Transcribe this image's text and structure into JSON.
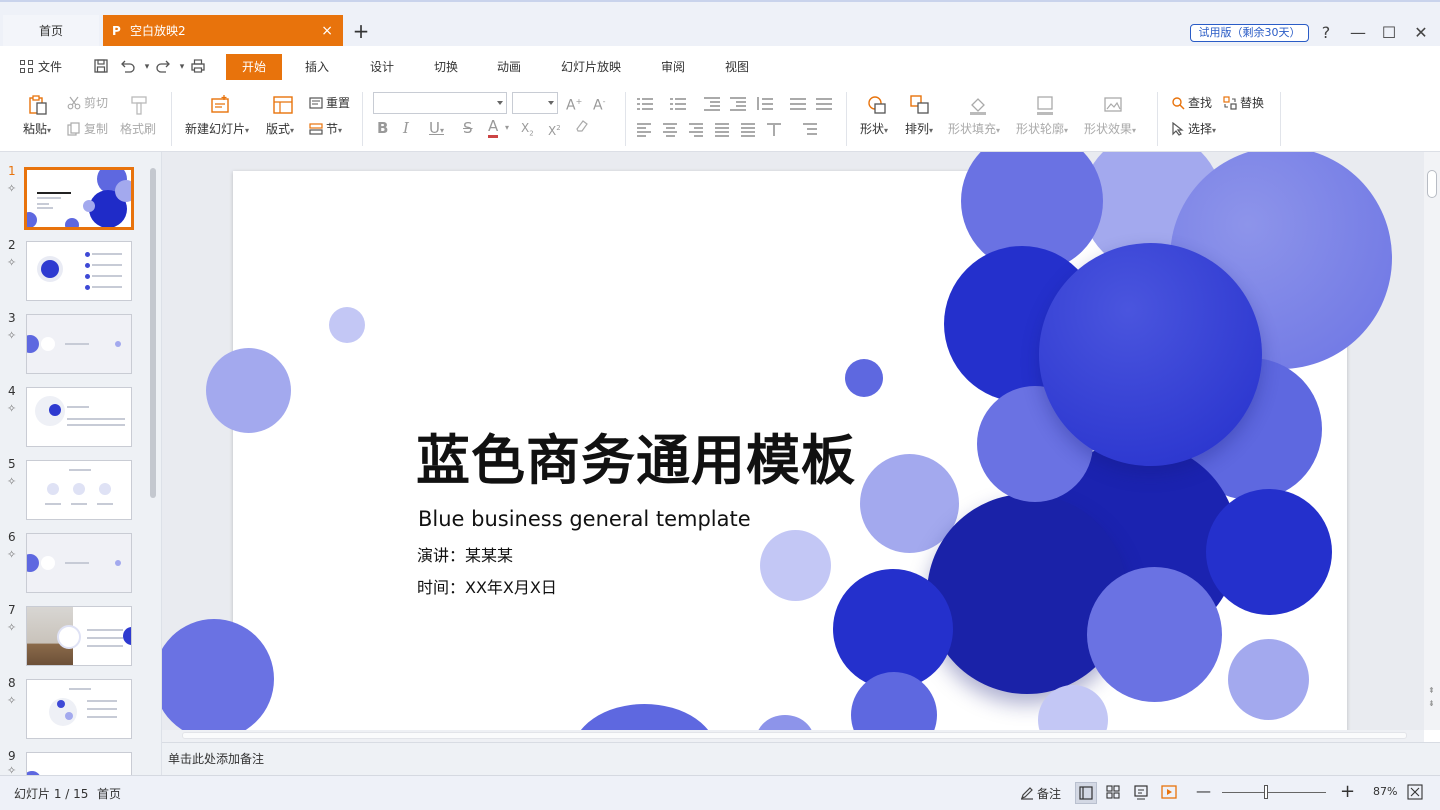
{
  "tabs": {
    "home": "首页",
    "document": "空白放映2",
    "logo": "P",
    "close": "×",
    "add": "+"
  },
  "trial_badge": "试用版（剩余30天）",
  "window_controls": {
    "help": "?",
    "minimize": "—",
    "maximize": "☐",
    "close": "✕"
  },
  "menu": {
    "file": "文件",
    "items": [
      "开始",
      "插入",
      "设计",
      "切换",
      "动画",
      "幻灯片放映",
      "审阅",
      "视图"
    ],
    "active_index": 0
  },
  "ribbon": {
    "paste": "粘贴",
    "cut": "剪切",
    "copy": "复制",
    "format_painter": "格式刷",
    "new_slide": "新建幻灯片",
    "layout": "版式",
    "reset": "重置",
    "section": "节",
    "shape": "形状",
    "arrange": "排列",
    "shape_fill": "形状填充",
    "shape_outline": "形状轮廓",
    "shape_effect": "形状效果",
    "find": "查找",
    "replace": "替换",
    "select": "选择",
    "font_name": "",
    "font_size": ""
  },
  "thumbnails": [
    "1",
    "2",
    "3",
    "4",
    "5",
    "6",
    "7",
    "8",
    "9"
  ],
  "selected_slide": 1,
  "slide": {
    "title": "蓝色商务通用模板",
    "subtitle": "Blue business general template",
    "presenter": "演讲：某某某",
    "date": "时间：XX年X月X日"
  },
  "notes_placeholder": "单击此处添加备注",
  "status": {
    "slide_counter": "幻灯片 1 / 15",
    "slide_name": "首页",
    "notes": "备注",
    "zoom": "87%",
    "zoom_minus": "—",
    "zoom_plus": "+"
  },
  "colors": {
    "accent": "#e8730c",
    "blue_dark": "#1f2bc8",
    "blue_mid": "#5e68e0",
    "blue_light": "#a3a9ee"
  }
}
